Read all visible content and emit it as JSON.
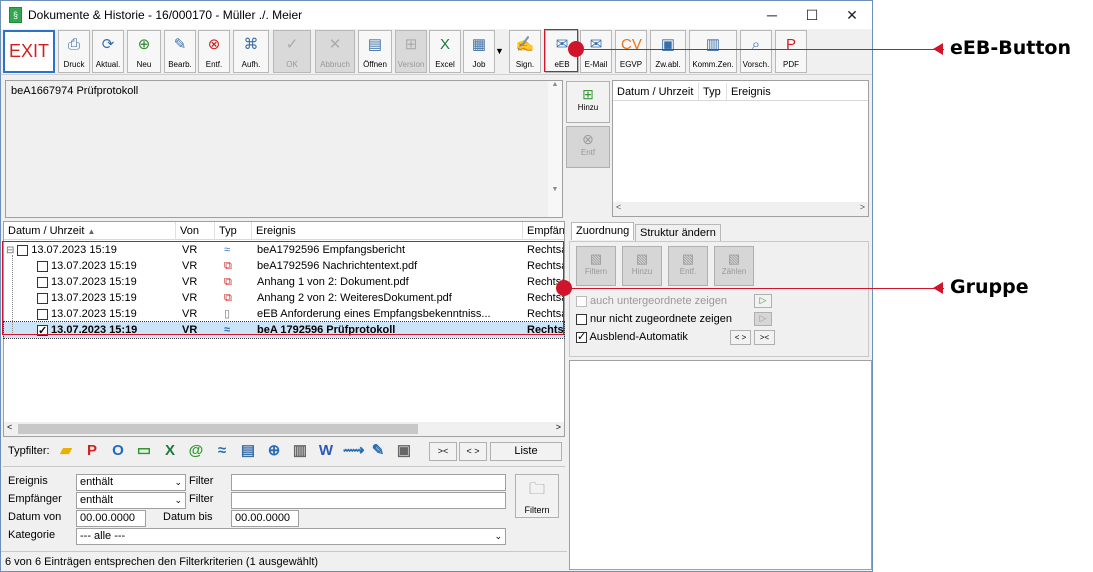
{
  "window": {
    "title": "Dokumente & Historie - 16/000170 - Müller ./. Meier",
    "minimize": "─",
    "maximize": "☐",
    "close": "✕"
  },
  "toolbar": {
    "exit": "EXIT",
    "buttons": [
      {
        "label": "Druck",
        "icon": "printer-icon",
        "disabled": false
      },
      {
        "label": "Aktual.",
        "icon": "refresh-doc-icon",
        "disabled": false
      },
      {
        "label": "Neu",
        "icon": "plus-icon",
        "disabled": false
      },
      {
        "label": "Bearb.",
        "icon": "pencil-icon",
        "disabled": false
      },
      {
        "label": "Entf.",
        "icon": "delete-icon",
        "disabled": false
      },
      {
        "label": "Aufh.",
        "icon": "network-icon",
        "disabled": false
      },
      {
        "label": "OK",
        "icon": "check-icon",
        "disabled": true
      },
      {
        "label": "Abbruch",
        "icon": "cancel-icon",
        "disabled": true
      },
      {
        "label": "Öffnen",
        "icon": "open-doc-icon",
        "disabled": false
      },
      {
        "label": "Version",
        "icon": "version-icon",
        "disabled": true
      },
      {
        "label": "Excel",
        "icon": "excel-icon",
        "disabled": false
      },
      {
        "label": "Job",
        "icon": "job-icon",
        "disabled": false
      },
      {
        "label": "Sign.",
        "icon": "sign-icon",
        "disabled": false
      },
      {
        "label": "eEB",
        "icon": "eeb-icon",
        "disabled": false
      },
      {
        "label": "E-Mail",
        "icon": "email-icon",
        "disabled": false
      },
      {
        "label": "EGVP",
        "icon": "cv-icon",
        "disabled": false
      },
      {
        "label": "Zw.abl.",
        "icon": "clipboard-icon",
        "disabled": false
      },
      {
        "label": "Komm.Zen.",
        "icon": "comm-center-icon",
        "disabled": false
      },
      {
        "label": "Vorsch.",
        "icon": "preview-icon",
        "disabled": false
      },
      {
        "label": "PDF",
        "icon": "pdf-icon",
        "disabled": false
      }
    ]
  },
  "annotations": {
    "eeb": "eEB-Button",
    "gruppe": "Gruppe"
  },
  "preview": {
    "text": "beA1667974 Prüfprotokoll"
  },
  "history": {
    "add": "Hinzu",
    "remove": "Entf",
    "headers": [
      "Datum / Uhrzeit",
      "Typ",
      "Ereignis"
    ]
  },
  "doclist": {
    "headers": [
      "Datum / Uhrzeit",
      "Von",
      "Typ",
      "Ereignis",
      "Empfän"
    ],
    "rows": [
      {
        "date": "13.07.2023  15:19",
        "von": "VR",
        "typ": "bea-icon",
        "event": "beA1792596 Empfangsbericht",
        "empf": "Rechtsa",
        "level": 0,
        "checked": false,
        "selected": false
      },
      {
        "date": "13.07.2023  15:19",
        "von": "VR",
        "typ": "pdf-icon",
        "event": "beA1792596 Nachrichtentext.pdf",
        "empf": "Rechtsa",
        "level": 1,
        "checked": false,
        "selected": false
      },
      {
        "date": "13.07.2023  15:19",
        "von": "VR",
        "typ": "pdf-icon",
        "event": "Anhang 1 von 2: Dokument.pdf",
        "empf": "Rechtsa",
        "level": 1,
        "checked": false,
        "selected": false
      },
      {
        "date": "13.07.2023  15:19",
        "von": "VR",
        "typ": "pdf-icon",
        "event": "Anhang 2 von 2: WeiteresDokument.pdf",
        "empf": "Rechtsa",
        "level": 1,
        "checked": false,
        "selected": false
      },
      {
        "date": "13.07.2023  15:19",
        "von": "VR",
        "typ": "doc-icon",
        "event": "eEB Anforderung eines Empfangsbekenntniss...",
        "empf": "Rechtsa",
        "level": 1,
        "checked": false,
        "selected": false
      },
      {
        "date": "13.07.2023  15:19",
        "von": "VR",
        "typ": "bea-icon",
        "event": "beA 1792596 Prüfprotokoll",
        "empf": "Rechtsa",
        "level": 1,
        "checked": true,
        "selected": true
      }
    ]
  },
  "tabs": [
    "Zuordnung",
    "Struktur ändern"
  ],
  "zuordnung": {
    "buttons": [
      "Filtern",
      "Hinzu",
      "Entf.",
      "Zählen"
    ],
    "options": [
      {
        "label": "auch untergeordnete zeigen",
        "checked": false,
        "disabled": true
      },
      {
        "label": "nur nicht zugeordnete zeigen",
        "checked": false,
        "disabled": false
      },
      {
        "label": "Ausblend-Automatik",
        "checked": true,
        "disabled": false
      }
    ],
    "nav1": "< >",
    "nav2": ">< "
  },
  "typfilter": {
    "label": "Typfilter:",
    "nav1": "><",
    "nav2": "< >",
    "liste": "Liste"
  },
  "filters": {
    "ereignis_label": "Ereignis",
    "ereignis_mode": "enthält",
    "empfaenger_label": "Empfänger",
    "empfaenger_mode": "enthält",
    "filter_label": "Filter",
    "datum_von_label": "Datum von",
    "datum_von": "00.00.0000",
    "datum_bis_label": "Datum bis",
    "datum_bis": "00.00.0000",
    "kategorie_label": "Kategorie",
    "kategorie": "--- alle ---",
    "filtern": "Filtern"
  },
  "status": "6 von 6 Einträgen entsprechen den Filterkriterien (1 ausgewählt)"
}
